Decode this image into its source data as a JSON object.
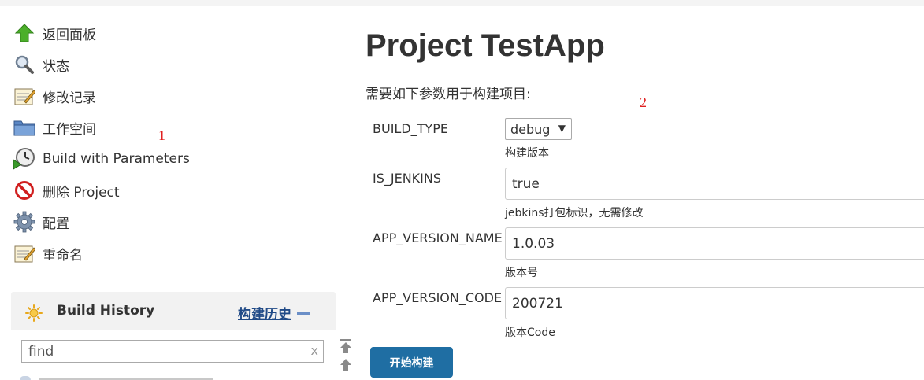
{
  "sidebar": {
    "items": [
      {
        "label": "返回面板",
        "icon": "arrow-up-icon"
      },
      {
        "label": "状态",
        "icon": "magnifier-icon"
      },
      {
        "label": "修改记录",
        "icon": "notepad-icon"
      },
      {
        "label": "工作空间",
        "icon": "folder-icon"
      },
      {
        "label": "Build with Parameters",
        "icon": "clock-play-icon"
      },
      {
        "label": "删除 Project",
        "icon": "no-entry-icon"
      },
      {
        "label": "配置",
        "icon": "gear-icon"
      },
      {
        "label": "重命名",
        "icon": "notepad-icon"
      }
    ]
  },
  "annotations": {
    "one": "1",
    "two": "2"
  },
  "build_history": {
    "title": "Build History",
    "trend_link": "构建历史",
    "search_value": "find",
    "clear_label": "x"
  },
  "main": {
    "title": "Project TestApp",
    "intro": "需要如下参数用于构建项目:",
    "params": [
      {
        "name": "BUILD_TYPE",
        "value": "debug",
        "description": "构建版本"
      },
      {
        "name": "IS_JENKINS",
        "value": "true",
        "description": "jebkins打包标识，无需修改"
      },
      {
        "name": "APP_VERSION_NAME",
        "value": "1.0.03",
        "description": "版本号"
      },
      {
        "name": "APP_VERSION_CODE",
        "value": "200721",
        "description": "版本Code"
      }
    ],
    "build_button": "开始构建"
  },
  "colors": {
    "accent": "#1f6ea3",
    "link": "#204a87",
    "annotation": "#e02020"
  }
}
